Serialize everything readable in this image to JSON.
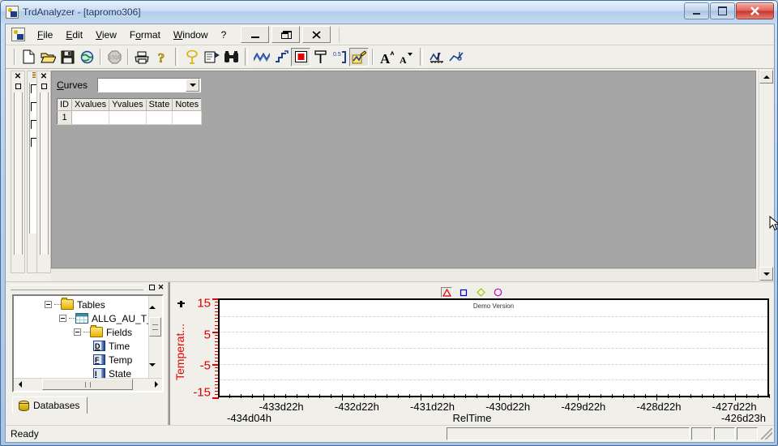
{
  "window": {
    "title": "TrdAnalyzer - [tapromo306]",
    "app_icon": "trdanalyzer-icon",
    "minimize": "–",
    "maximize": "❐",
    "close": "✕"
  },
  "menu": {
    "items": [
      {
        "name": "file",
        "label": "File",
        "accel": "F"
      },
      {
        "name": "edit",
        "label": "Edit",
        "accel": "E"
      },
      {
        "name": "view",
        "label": "View",
        "accel": "V"
      },
      {
        "name": "format",
        "label": "Format",
        "accel": "o"
      },
      {
        "name": "window",
        "label": "Window",
        "accel": "W"
      },
      {
        "name": "help",
        "label": "?",
        "accel": ""
      }
    ],
    "mdi_minimize": "_",
    "mdi_restore": "❐",
    "mdi_close": "✕"
  },
  "toolbar": {
    "buttons": [
      {
        "name": "new-icon",
        "title": "New"
      },
      {
        "name": "open-folder-icon",
        "title": "Open"
      },
      {
        "name": "save-disk-icon",
        "title": "Save"
      },
      {
        "name": "globe-icon",
        "title": "Connect"
      },
      {
        "name": "stop-icon",
        "title": "Stop"
      },
      {
        "name": "print-icon",
        "title": "Print"
      },
      {
        "name": "help-question-icon",
        "title": "Help"
      },
      {
        "name": "lasso-icon",
        "title": "Select"
      },
      {
        "name": "properties-icon",
        "title": "Properties"
      },
      {
        "name": "binoculars-icon",
        "title": "Find"
      },
      {
        "name": "waveform-icon",
        "title": "Curves"
      },
      {
        "name": "step-curve-icon",
        "title": "Step"
      },
      {
        "name": "stop-record-icon",
        "title": "Stop Record"
      },
      {
        "name": "pin-icon",
        "title": "Pin"
      },
      {
        "name": "decimal-icon",
        "title": "Decimals"
      },
      {
        "name": "edit-curve-icon",
        "title": "Edit Curve"
      },
      {
        "name": "font-larger-icon",
        "title": "Increase Font"
      },
      {
        "name": "font-smaller-icon",
        "title": "Decrease Font"
      },
      {
        "name": "axis-chart-icon",
        "title": "Axis"
      },
      {
        "name": "marker-chart-icon",
        "title": "Markers"
      }
    ]
  },
  "curves_panel": {
    "label": "Curves",
    "label_accel": "C",
    "combo_value": "",
    "combo_placeholder": "",
    "grid": {
      "columns": [
        "ID",
        "Xvalues",
        "Yvalues",
        "State",
        "Notes"
      ],
      "rows": [
        {
          "ID": "1",
          "Xvalues": "",
          "Yvalues": "",
          "State": "",
          "Notes": ""
        }
      ]
    }
  },
  "left_dock": {
    "close_glyph": "✕",
    "restore_glyph": "❐"
  },
  "databases_panel": {
    "caption_restore": "❐",
    "caption_close": "✕",
    "tree": [
      {
        "label": "Tables",
        "indent": 0,
        "icon": "folder-icon",
        "expander": "−"
      },
      {
        "label": "ALLG_AU_T_",
        "indent": 1,
        "icon": "table-icon",
        "expander": "−"
      },
      {
        "label": "Fields",
        "indent": 2,
        "icon": "folder-icon",
        "expander": "−"
      },
      {
        "label": "Time",
        "indent": 3,
        "icon": "field-date-icon",
        "expander": "",
        "field_type": "D"
      },
      {
        "label": "Temp",
        "indent": 3,
        "icon": "field-float-icon",
        "expander": "",
        "field_type": "F"
      },
      {
        "label": "State",
        "indent": 3,
        "icon": "field-int-icon",
        "expander": "",
        "field_type": "I"
      }
    ],
    "tab_label": "Databases",
    "tab_icon": "database-icon"
  },
  "chart_data": {
    "type": "line",
    "title": "Demo Version",
    "xlabel": "RelTime",
    "ylabel": "Temperat...",
    "ylabel_full": "Temperature",
    "ylim": [
      -15,
      15
    ],
    "ytick_labels": [
      "15",
      "5",
      "-5",
      "-15"
    ],
    "ytick_values": [
      15,
      5,
      -5,
      -15
    ],
    "yminor_step": 1,
    "grid": true,
    "gridlines_y": [
      10,
      5,
      0,
      -5,
      -10
    ],
    "x_range_start": "-434d04h",
    "x_range_end": "-426d23h",
    "xtick_labels": [
      "-433d22h",
      "-432d22h",
      "-431d22h",
      "-430d22h",
      "-429d22h",
      "-428d22h",
      "-427d22h"
    ],
    "series": [],
    "legend": {
      "position": "top-center",
      "entries": [
        {
          "name": "legend-marker-triangle",
          "marker": "triangle",
          "color": "#e00000",
          "selected": true
        },
        {
          "name": "legend-marker-square",
          "marker": "square",
          "color": "#0000cc",
          "selected": false
        },
        {
          "name": "legend-marker-diamond",
          "marker": "diamond",
          "color": "#99cc00",
          "selected": false
        },
        {
          "name": "legend-marker-circle",
          "marker": "circle",
          "color": "#cc00cc",
          "selected": false
        }
      ]
    }
  },
  "statusbar": {
    "message": "Ready",
    "panels": [
      "",
      "",
      "",
      ""
    ]
  },
  "colors": {
    "axis_red": "#e00000",
    "title_blue": "#14335e",
    "mdi_background": "#a6a6a6",
    "face": "#f0efe9"
  }
}
